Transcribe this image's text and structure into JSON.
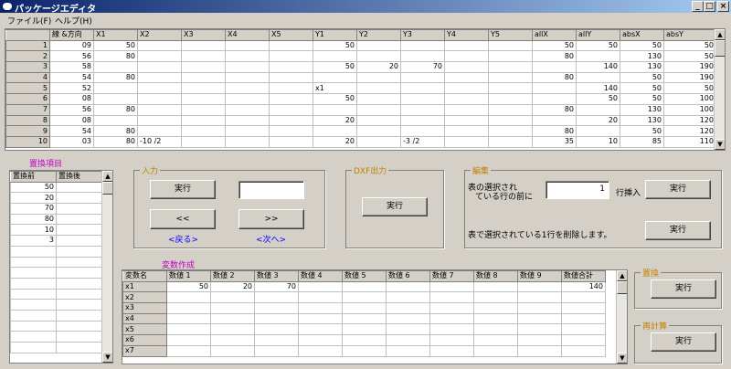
{
  "window": {
    "title": "パッケージエディタ",
    "min": "_",
    "max": "□",
    "close": "×"
  },
  "menu": [
    "ファイル(F)",
    "ヘルプ(H)"
  ],
  "main_grid": {
    "headers": [
      "",
      "線 &方向",
      "X1",
      "X2",
      "X3",
      "X4",
      "X5",
      "Y1",
      "Y2",
      "Y3",
      "Y4",
      "Y5",
      "allX",
      "allY",
      "absX",
      "absY"
    ],
    "rows": [
      [
        "1",
        "09",
        "50",
        "",
        "",
        "",
        "",
        "50",
        "",
        "",
        "",
        "",
        "50",
        "50",
        "50",
        "50"
      ],
      [
        "2",
        "56",
        "80",
        "",
        "",
        "",
        "",
        "",
        "",
        "",
        "",
        "",
        "80",
        "",
        "130",
        "50"
      ],
      [
        "3",
        "58",
        "",
        "",
        "",
        "",
        "",
        "50",
        "20",
        "70",
        "",
        "",
        "",
        "140",
        "130",
        "190"
      ],
      [
        "4",
        "54",
        "80",
        "",
        "",
        "",
        "",
        "",
        "",
        "",
        "",
        "",
        "80",
        "",
        "50",
        "190"
      ],
      [
        "5",
        "52",
        "",
        "",
        "",
        "",
        "",
        "x1",
        "",
        "",
        "",
        "",
        "",
        "140",
        "50",
        "50"
      ],
      [
        "6",
        "08",
        "",
        "",
        "",
        "",
        "",
        "50",
        "",
        "",
        "",
        "",
        "",
        "50",
        "50",
        "100"
      ],
      [
        "7",
        "56",
        "80",
        "",
        "",
        "",
        "",
        "",
        "",
        "",
        "",
        "",
        "80",
        "",
        "130",
        "100"
      ],
      [
        "8",
        "08",
        "",
        "",
        "",
        "",
        "",
        "20",
        "",
        "",
        "",
        "",
        "",
        "20",
        "130",
        "120"
      ],
      [
        "9",
        "54",
        "80",
        "",
        "",
        "",
        "",
        "",
        "",
        "",
        "",
        "",
        "80",
        "",
        "50",
        "120"
      ],
      [
        "10",
        "03",
        "80",
        "-10 /2",
        "",
        "",
        "",
        "20",
        "",
        "-3 /2",
        "",
        "",
        "35",
        "10",
        "85",
        "110"
      ]
    ]
  },
  "replace_items": {
    "title": "置換項目",
    "headers": [
      "置換前",
      "置換後"
    ],
    "rows": [
      [
        "50",
        ""
      ],
      [
        "20",
        ""
      ],
      [
        "70",
        ""
      ],
      [
        "80",
        ""
      ],
      [
        "10",
        ""
      ],
      [
        "3",
        ""
      ]
    ]
  },
  "input_group": {
    "title": "入力",
    "exec_label": "実行",
    "input_value": "",
    "back_label": "<<",
    "next_label": ">>",
    "back_text": "<戻る>",
    "next_text": "<次へ>"
  },
  "dxf_group": {
    "title": "DXF出力",
    "exec_label": "実行"
  },
  "edit_group": {
    "title": "編集",
    "insert_text_1": "表の選択され",
    "insert_text_2": "ている行の前に",
    "insert_count": "1",
    "insert_suffix": "行挿入",
    "insert_exec": "実行",
    "delete_text": "表で選択されている1行を削除します。",
    "delete_exec": "実行"
  },
  "variables": {
    "title": "変数作成",
    "headers": [
      "変数名",
      "数値 1",
      "数値 2",
      "数値 3",
      "数値 4",
      "数値 5",
      "数値 6",
      "数値 7",
      "数値 8",
      "数値 9",
      "数値合計"
    ],
    "rows": [
      [
        "x1",
        "50",
        "20",
        "70",
        "",
        "",
        "",
        "",
        "",
        "",
        "140"
      ],
      [
        "x2",
        "",
        "",
        "",
        "",
        "",
        "",
        "",
        "",
        "",
        ""
      ],
      [
        "x3",
        "",
        "",
        "",
        "",
        "",
        "",
        "",
        "",
        "",
        ""
      ],
      [
        "x4",
        "",
        "",
        "",
        "",
        "",
        "",
        "",
        "",
        "",
        ""
      ],
      [
        "x5",
        "",
        "",
        "",
        "",
        "",
        "",
        "",
        "",
        "",
        ""
      ],
      [
        "x6",
        "",
        "",
        "",
        "",
        "",
        "",
        "",
        "",
        "",
        ""
      ],
      [
        "x7",
        "",
        "",
        "",
        "",
        "",
        "",
        "",
        "",
        "",
        ""
      ]
    ]
  },
  "replace_group": {
    "title": "置換",
    "exec_label": "実行"
  },
  "recalc_group": {
    "title": "再計算",
    "exec_label": "実行"
  },
  "scroll": {
    "up": "▲",
    "down": "▼"
  }
}
